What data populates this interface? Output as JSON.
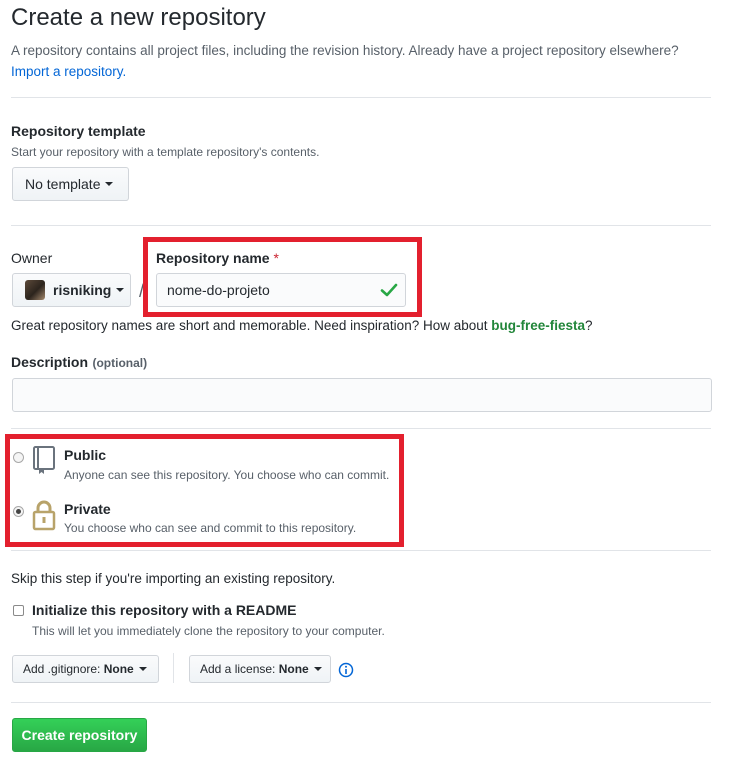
{
  "page": {
    "title": "Create a new repository",
    "subtitle": "A repository contains all project files, including the revision history. Already have a project repository elsewhere?",
    "import_link": "Import a repository."
  },
  "template": {
    "label": "Repository template",
    "note": "Start your repository with a template repository's contents.",
    "button": "No template"
  },
  "owner": {
    "label": "Owner",
    "value": "risniking"
  },
  "repo_name": {
    "label": "Repository name",
    "required_mark": "*",
    "value": "nome-do-projeto",
    "separator": "/"
  },
  "name_hint": {
    "text": "Great repository names are short and memorable. Need inspiration? How about",
    "suggestion": "bug-free-fiesta",
    "suffix": "?"
  },
  "description": {
    "label": "Description",
    "optional": "(optional)",
    "value": ""
  },
  "visibility": {
    "public_label": "Public",
    "public_note": "Anyone can see this repository. You choose who can commit.",
    "private_label": "Private",
    "private_note": "You choose who can see and commit to this repository.",
    "selected": "private"
  },
  "init": {
    "skip_note": "Skip this step if you're importing an existing repository.",
    "readme_label": "Initialize this repository with a README",
    "readme_note": "This will let you immediately clone the repository to your computer.",
    "readme_checked": false
  },
  "options": {
    "gitignore_prefix": "Add .gitignore:",
    "gitignore_value": "None",
    "license_prefix": "Add a license:",
    "license_value": "None"
  },
  "submit": {
    "label": "Create repository"
  },
  "colors": {
    "highlight": "#e3202e",
    "primary": "#28a745",
    "link": "#0366d6",
    "valid_check": "#28a745"
  }
}
